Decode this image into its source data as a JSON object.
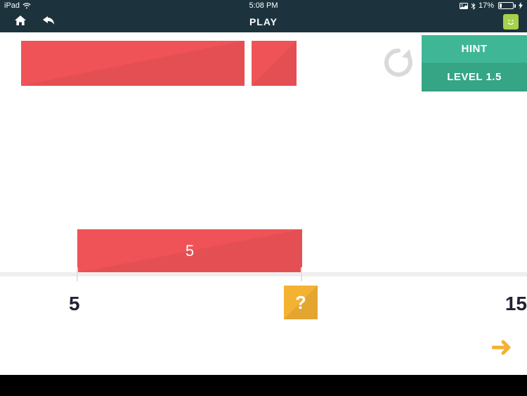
{
  "status": {
    "device": "iPad",
    "time": "5:08 PM",
    "battery_pct": "17%"
  },
  "nav": {
    "title": "PLAY"
  },
  "side": {
    "hint": "HINT",
    "level": "LEVEL 1.5"
  },
  "game": {
    "bar_value": "5",
    "tick_left_label": "5",
    "tick_right_label": "15",
    "question_mark": "?"
  },
  "icons": {
    "home": "home-icon",
    "back": "back-arrow-icon",
    "refresh": "refresh-icon",
    "smiley": "smiley-icon",
    "next": "next-arrow-icon",
    "wifi": "wifi-icon",
    "picture": "picture-icon",
    "bluetooth": "bluetooth-icon",
    "bolt": "bolt-icon"
  }
}
